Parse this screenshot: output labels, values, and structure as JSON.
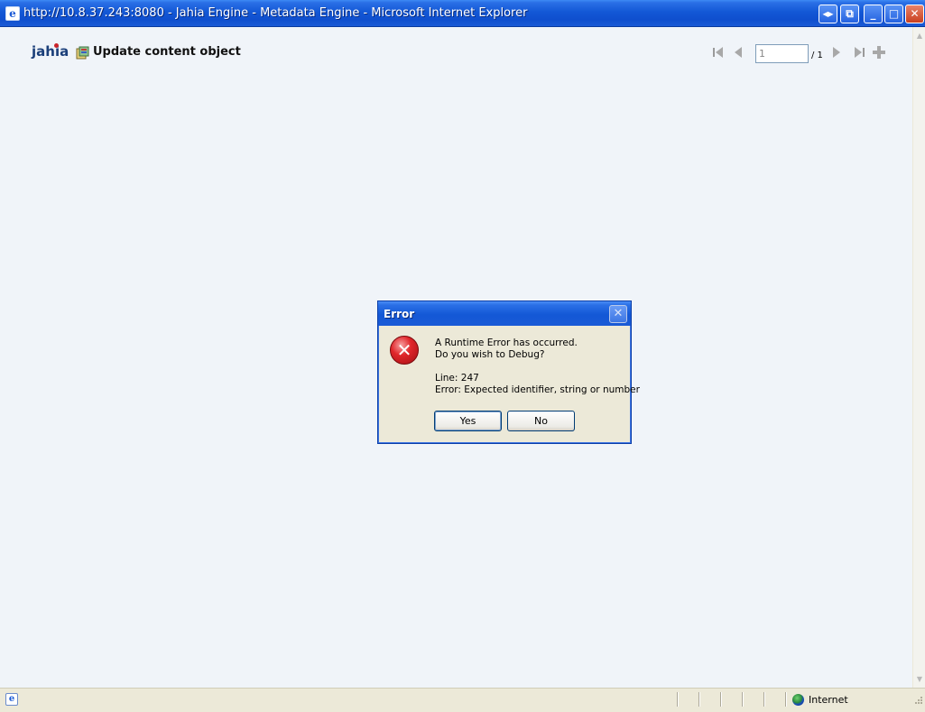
{
  "window": {
    "title": "http://10.8.37.243:8080 - Jahia Engine - Metadata Engine - Microsoft Internet Explorer",
    "app_icon_glyph": "e",
    "buttons": {
      "restore_glyph": "◂▸",
      "window_glyph": "⧉",
      "minimize_glyph": "_",
      "maximize_glyph": "□",
      "close_glyph": "✕"
    }
  },
  "page": {
    "logo": "jahia",
    "heading": "Update content object",
    "pagination": {
      "current": "1",
      "total_label": "/ 1"
    }
  },
  "dialog": {
    "title": "Error",
    "close_glyph": "✕",
    "icon_glyph": "✕",
    "message_line1": "A Runtime Error has occurred.",
    "message_line2": "Do you wish to Debug?",
    "line_info": "Line: 247",
    "error_info": "Error: Expected identifier, string or number",
    "yes_label": "Yes",
    "no_label": "No"
  },
  "statusbar": {
    "icon_glyph": "e",
    "zone": "Internet"
  },
  "scrollbar": {
    "up_glyph": "▲",
    "down_glyph": "▼"
  },
  "colors": {
    "titlebar": "#1358d6",
    "page_background": "#f0f4f9",
    "dialog_background": "#ece9d8",
    "error_red": "#e0262a"
  },
  "icons": [
    "ie-icon",
    "content-object-icon",
    "first-page-icon",
    "previous-page-icon",
    "next-page-icon",
    "last-page-icon",
    "add-icon",
    "error-icon",
    "internet-zone-icon"
  ]
}
